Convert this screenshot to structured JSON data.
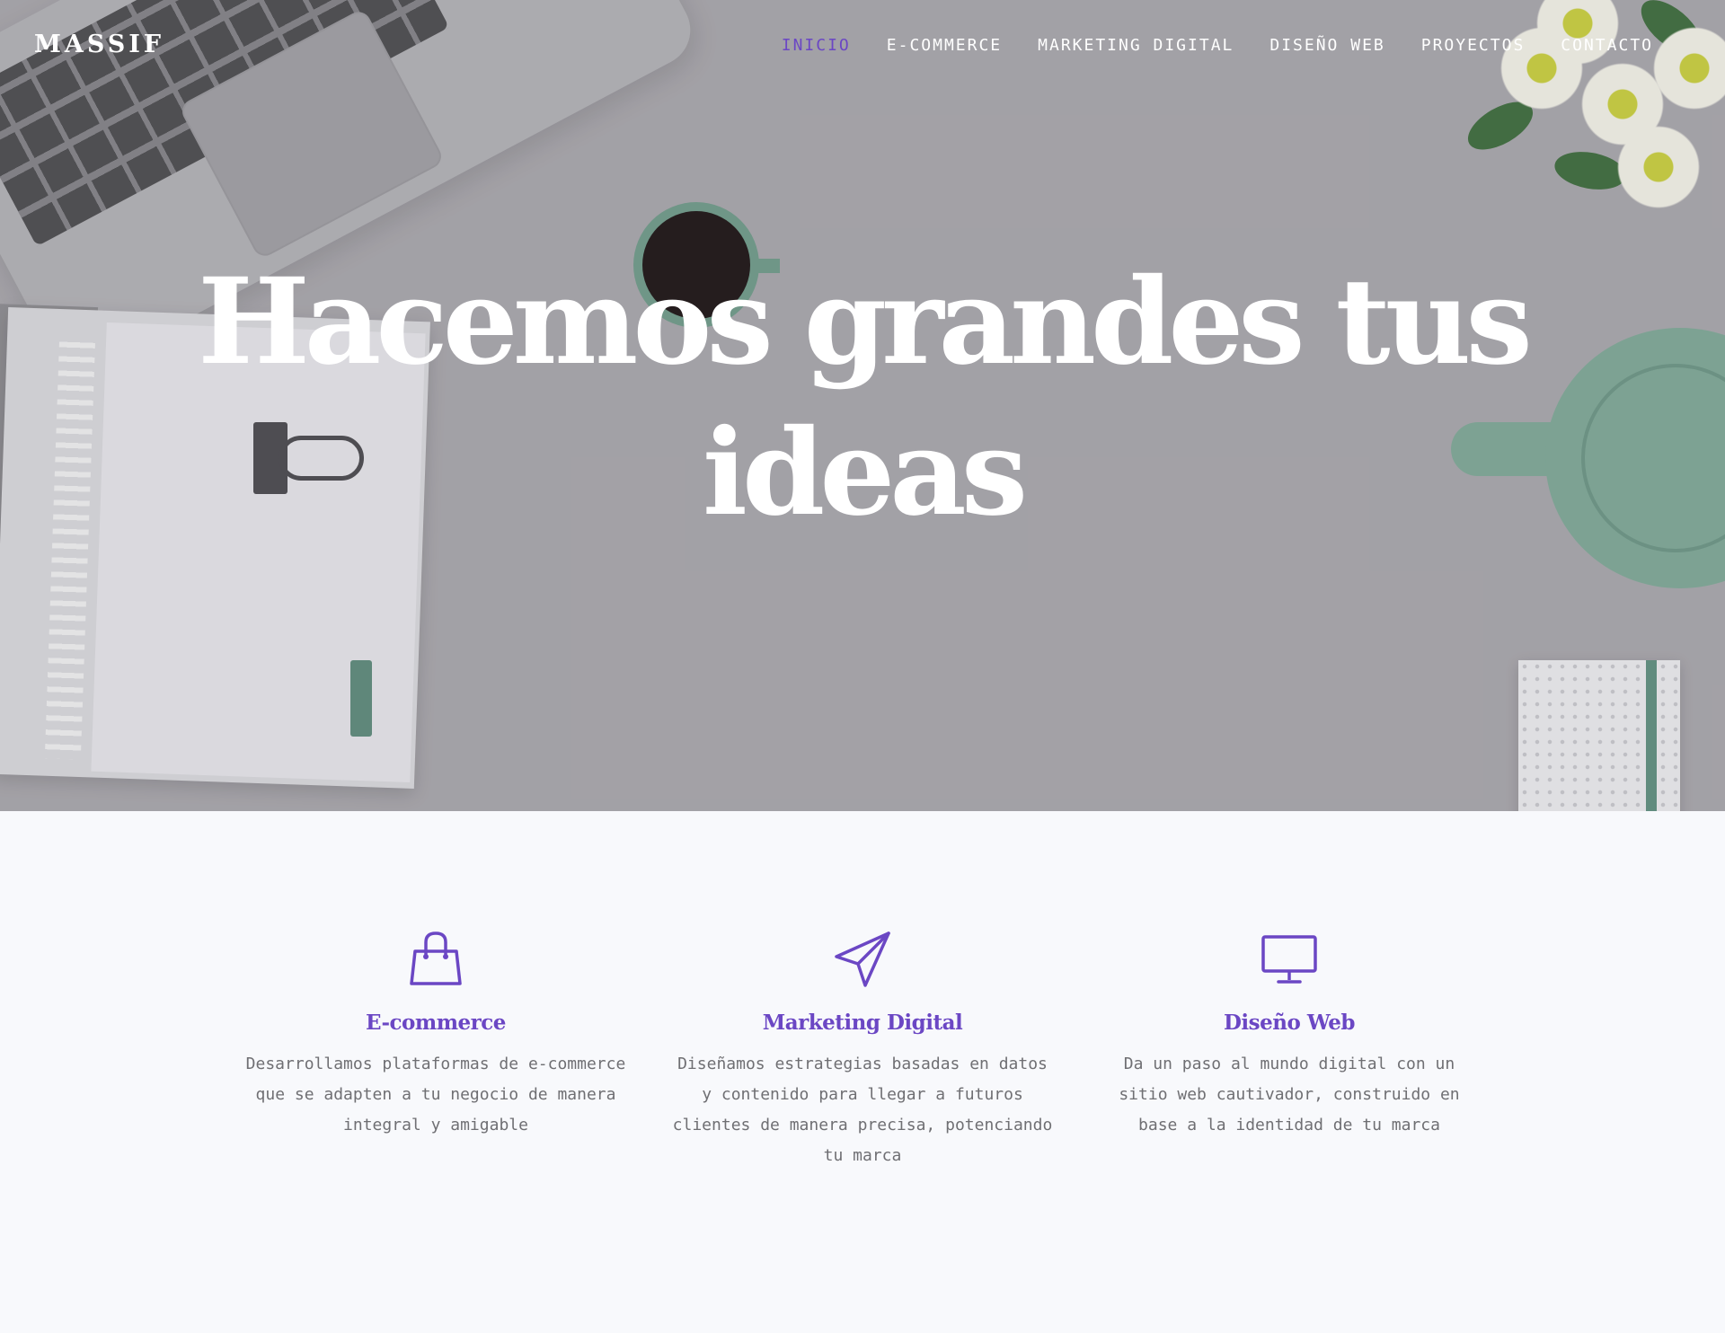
{
  "brand": {
    "logo": "MASSIF",
    "accent_color": "#6b47c4"
  },
  "nav": {
    "items": [
      {
        "label": "INICIO",
        "active": true
      },
      {
        "label": "E-COMMERCE",
        "active": false
      },
      {
        "label": "MARKETING DIGITAL",
        "active": false
      },
      {
        "label": "DISEÑO WEB",
        "active": false
      },
      {
        "label": "PROYECTOS",
        "active": false
      },
      {
        "label": "CONTACTO",
        "active": false
      }
    ]
  },
  "hero": {
    "title_line1": "Hacemos grandes tus",
    "title_line2": "ideas"
  },
  "services": [
    {
      "icon": "shopping-bag-icon",
      "title": "E-commerce",
      "description": "Desarrollamos plataformas de e-commerce que se adapten a tu negocio de manera integral y amigable"
    },
    {
      "icon": "paper-plane-icon",
      "title": "Marketing Digital",
      "description": "Diseñamos estrategias basadas en datos y contenido para llegar a futuros clientes de manera precisa, potenciando tu marca"
    },
    {
      "icon": "monitor-icon",
      "title": "Diseño Web",
      "description": "Da un paso al mundo digital con un sitio web cautivador, construido en base a la identidad de tu marca"
    }
  ]
}
